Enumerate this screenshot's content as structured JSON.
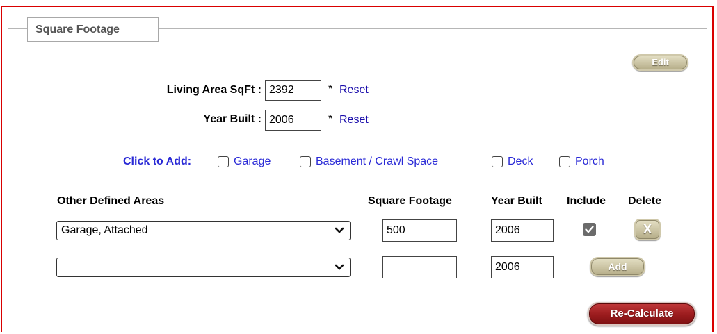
{
  "panel": {
    "legend_title": "Square Footage"
  },
  "buttons": {
    "edit": "Edit",
    "add": "Add",
    "delete": "X",
    "recalculate": "Re-Calculate"
  },
  "living_area": {
    "label": "Living Area SqFt :",
    "value": "2392",
    "required_mark": "*",
    "reset_link": "Reset"
  },
  "year_built": {
    "label": "Year Built :",
    "value": "2006",
    "required_mark": "*",
    "reset_link": "Reset"
  },
  "click_to_add": {
    "label": "Click to Add:",
    "options": [
      "Garage",
      "Basement / Crawl Space",
      "Deck",
      "Porch"
    ]
  },
  "table": {
    "headers": [
      "Other Defined Areas",
      "Square Footage",
      "Year Built",
      "Include",
      "Delete"
    ],
    "rows": [
      {
        "area": "Garage, Attached",
        "square_footage": "500",
        "year_built": "2006",
        "include": true
      },
      {
        "area": "",
        "square_footage": "",
        "year_built": "2006"
      }
    ]
  },
  "icons": {
    "dropdown": "chevron-down-icon",
    "include_checkbox": "check-icon"
  }
}
